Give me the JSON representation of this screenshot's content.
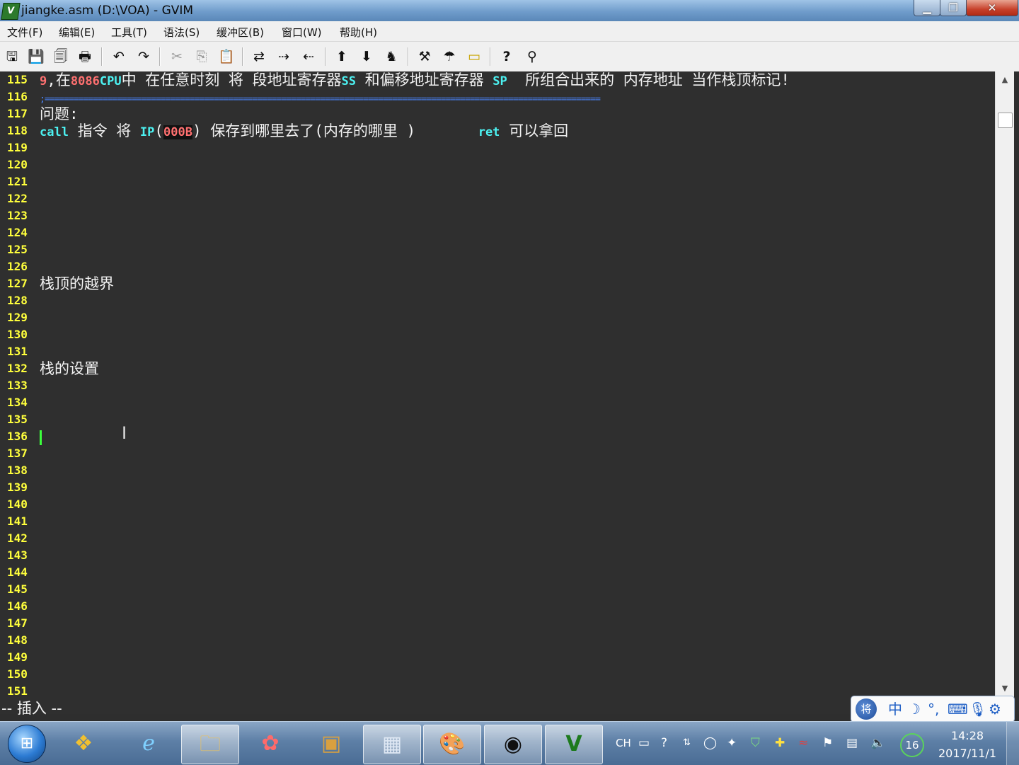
{
  "window": {
    "title": "jiangke.asm (D:\\VOA) - GVIM",
    "app_icon": "vim-icon",
    "controls": {
      "minimize": "minimize-icon",
      "maximize": "restore-icon",
      "close": "close-icon"
    }
  },
  "menu": [
    {
      "label": "文件(F)"
    },
    {
      "label": "编辑(E)"
    },
    {
      "label": "工具(T)"
    },
    {
      "label": "语法(S)"
    },
    {
      "label": "缓冲区(B)"
    },
    {
      "label": "窗口(W)"
    },
    {
      "label": "帮助(H)"
    }
  ],
  "toolbar": [
    {
      "name": "open-icon",
      "glyph": "🖫"
    },
    {
      "name": "save-icon",
      "glyph": "💾"
    },
    {
      "name": "save-all-icon",
      "glyph": "🗐"
    },
    {
      "name": "print-icon",
      "glyph": "🖶"
    },
    {
      "name": "undo-icon",
      "glyph": "↶"
    },
    {
      "name": "redo-icon",
      "glyph": "↷"
    },
    {
      "name": "cut-icon",
      "glyph": "✂"
    },
    {
      "name": "copy-icon",
      "glyph": "⎘"
    },
    {
      "name": "paste-icon",
      "glyph": "📋"
    },
    {
      "name": "replace-icon",
      "glyph": "⇄"
    },
    {
      "name": "find-next-icon",
      "glyph": "⇢"
    },
    {
      "name": "find-prev-icon",
      "glyph": "⇠"
    },
    {
      "name": "load-session-icon",
      "glyph": "⬆"
    },
    {
      "name": "save-session-icon",
      "glyph": "⬇"
    },
    {
      "name": "run-script-icon",
      "glyph": "♞"
    },
    {
      "name": "make-icon",
      "glyph": "⚒"
    },
    {
      "name": "shell-icon",
      "glyph": "☂"
    },
    {
      "name": "tags-icon",
      "glyph": "▭"
    },
    {
      "name": "help-icon",
      "glyph": "?"
    },
    {
      "name": "find-help-icon",
      "glyph": "⚲"
    }
  ],
  "editor": {
    "colors": {
      "background": "#2f2f2f",
      "line_number": "#ffff3c",
      "text": "#f2f2f2",
      "keyword": "#4cf2f2",
      "number": "#ff7070",
      "cursor": "#3cff3c"
    },
    "lines": [
      {
        "n": "115",
        "segments": [
          {
            "t": "9",
            "c": "num"
          },
          {
            "t": ",在",
            "c": ""
          },
          {
            "t": "8086",
            "c": "num"
          },
          {
            "t": "CPU",
            "c": "kw"
          },
          {
            "t": "中 在任意时刻 将 段地址寄存器",
            "c": ""
          },
          {
            "t": "SS",
            "c": "kw"
          },
          {
            "t": " 和偏移地址寄存器 ",
            "c": ""
          },
          {
            "t": "SP",
            "c": "kw"
          },
          {
            "t": "  所组合出来的 内存地址 当作栈顶标记!",
            "c": ""
          }
        ]
      },
      {
        "n": "116",
        "segments": [
          {
            "t": ";===================================================================================================================",
            "c": "sep"
          }
        ]
      },
      {
        "n": "117",
        "segments": [
          {
            "t": "问题:",
            "c": ""
          }
        ]
      },
      {
        "n": "118",
        "segments": [
          {
            "t": "call",
            "c": "kw"
          },
          {
            "t": " 指令 将 ",
            "c": ""
          },
          {
            "t": "IP",
            "c": "kw"
          },
          {
            "t": "(",
            "c": ""
          },
          {
            "t": "000B",
            "c": "lit"
          },
          {
            "t": ") 保存到哪里去了(内存的哪里 )       ",
            "c": ""
          },
          {
            "t": "ret",
            "c": "kw"
          },
          {
            "t": " 可以拿回",
            "c": ""
          }
        ]
      },
      {
        "n": "119",
        "segments": []
      },
      {
        "n": "120",
        "segments": []
      },
      {
        "n": "121",
        "segments": []
      },
      {
        "n": "122",
        "segments": []
      },
      {
        "n": "123",
        "segments": []
      },
      {
        "n": "124",
        "segments": []
      },
      {
        "n": "125",
        "segments": []
      },
      {
        "n": "126",
        "segments": []
      },
      {
        "n": "127",
        "segments": [
          {
            "t": "栈顶的越界",
            "c": ""
          }
        ]
      },
      {
        "n": "128",
        "segments": []
      },
      {
        "n": "129",
        "segments": []
      },
      {
        "n": "130",
        "segments": []
      },
      {
        "n": "131",
        "segments": []
      },
      {
        "n": "132",
        "segments": [
          {
            "t": "栈的设置",
            "c": ""
          }
        ]
      },
      {
        "n": "133",
        "segments": []
      },
      {
        "n": "134",
        "segments": []
      },
      {
        "n": "135",
        "segments": []
      },
      {
        "n": "136",
        "segments": [],
        "cursor": true
      },
      {
        "n": "137",
        "segments": []
      },
      {
        "n": "138",
        "segments": []
      },
      {
        "n": "139",
        "segments": []
      },
      {
        "n": "140",
        "segments": []
      },
      {
        "n": "141",
        "segments": []
      },
      {
        "n": "142",
        "segments": []
      },
      {
        "n": "143",
        "segments": []
      },
      {
        "n": "144",
        "segments": []
      },
      {
        "n": "145",
        "segments": []
      },
      {
        "n": "146",
        "segments": []
      },
      {
        "n": "147",
        "segments": []
      },
      {
        "n": "148",
        "segments": []
      },
      {
        "n": "149",
        "segments": []
      },
      {
        "n": "150",
        "segments": []
      },
      {
        "n": "151",
        "segments": []
      }
    ]
  },
  "mode_line": "-- 插入 --",
  "ime": {
    "logo": "将",
    "items": [
      {
        "name": "ime-chinese-mode",
        "glyph": "中"
      },
      {
        "name": "ime-halfwidth-icon",
        "glyph": "☽"
      },
      {
        "name": "ime-punctuation-icon",
        "glyph": "°,"
      },
      {
        "name": "ime-keyboard-icon",
        "glyph": "⌨"
      },
      {
        "name": "ime-voice-icon",
        "glyph": "🎙"
      },
      {
        "name": "ime-settings-icon",
        "glyph": "⚙"
      }
    ]
  },
  "taskbar": {
    "start": "start-orb-icon",
    "apps": [
      {
        "name": "taskbar-app-folder-icon",
        "glyph": "❖"
      },
      {
        "name": "taskbar-app-ie-icon",
        "glyph": "ℯ"
      },
      {
        "name": "taskbar-app-explorer-icon",
        "glyph": "🗀"
      },
      {
        "name": "taskbar-app-picasa-icon",
        "glyph": "✿"
      },
      {
        "name": "taskbar-app-dosbox-icon",
        "glyph": "▣"
      },
      {
        "name": "taskbar-app-calculator-icon",
        "glyph": "▦"
      },
      {
        "name": "taskbar-app-paint-icon",
        "glyph": "🎨"
      },
      {
        "name": "taskbar-app-obs-icon",
        "glyph": "◉"
      },
      {
        "name": "taskbar-app-gvim-icon",
        "glyph": "V"
      }
    ],
    "tray": {
      "lang": "CH",
      "icons": [
        "keyboard-icon",
        "help-icon",
        "arrow-icon",
        "shield-icon",
        "satellite-icon",
        "security-icon",
        "plus-icon",
        "wifi-icon",
        "flag-icon",
        "network-icon",
        "volume-icon"
      ],
      "badge": "16"
    },
    "clock": {
      "time": "14:28",
      "date": "2017/11/1"
    }
  }
}
